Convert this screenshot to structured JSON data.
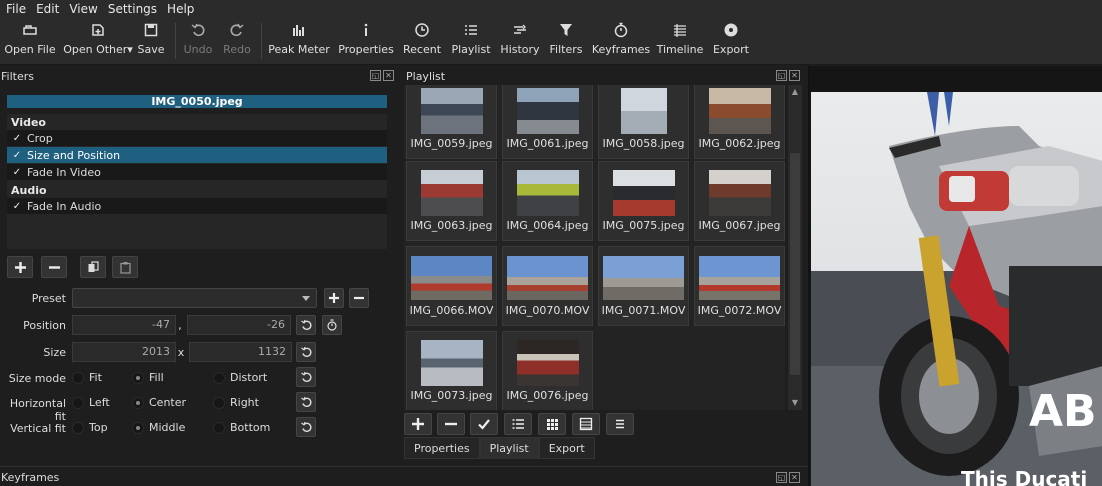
{
  "menu": [
    "File",
    "Edit",
    "View",
    "Settings",
    "Help"
  ],
  "toolbar": {
    "open_file": "Open File",
    "open_other": "Open Other",
    "save": "Save",
    "undo": "Undo",
    "redo": "Redo",
    "peak_meter": "Peak Meter",
    "properties": "Properties",
    "recent": "Recent",
    "playlist": "Playlist",
    "history": "History",
    "filters": "Filters",
    "keyframes": "Keyframes",
    "timeline": "Timeline",
    "export": "Export"
  },
  "filters": {
    "title": "Filters",
    "clip_name": "IMG_0050.jpeg",
    "video_label": "Video",
    "audio_label": "Audio",
    "video_filters": [
      {
        "check": "✓",
        "name": "Crop",
        "selected": false
      },
      {
        "check": "✓",
        "name": "Size and Position",
        "selected": true
      },
      {
        "check": "✓",
        "name": "Fade In Video",
        "selected": false
      }
    ],
    "audio_filters": [
      {
        "check": "✓",
        "name": "Fade In Audio",
        "selected": false
      }
    ]
  },
  "params": {
    "preset_label": "Preset",
    "preset_value": "",
    "position_label": "Position",
    "position_x": "-47",
    "position_sep": ",",
    "position_y": "-26",
    "size_label": "Size",
    "size_w": "2013",
    "size_sep": "x",
    "size_h": "1132",
    "size_mode_label": "Size mode",
    "size_mode_options": [
      "Fit",
      "Fill",
      "Distort"
    ],
    "size_mode_selected": "Fill",
    "hfit_label": "Horizontal fit",
    "hfit_options": [
      "Left",
      "Center",
      "Right"
    ],
    "hfit_selected": "Center",
    "vfit_label": "Vertical fit",
    "vfit_options": [
      "Top",
      "Middle",
      "Bottom"
    ],
    "vfit_selected": "Middle"
  },
  "playlist": {
    "title": "Playlist",
    "items": [
      "IMG_0059.jpeg",
      "IMG_0061.jpeg",
      "IMG_0058.jpeg",
      "IMG_0062.jpeg",
      "IMG_0063.jpeg",
      "IMG_0064.jpeg",
      "IMG_0075.jpeg",
      "IMG_0067.jpeg",
      "IMG_0066.MOV",
      "IMG_0070.MOV",
      "IMG_0071.MOV",
      "IMG_0072.MOV",
      "IMG_0073.jpeg",
      "IMG_0076.jpeg"
    ],
    "tabs": [
      "Properties",
      "Playlist",
      "Export"
    ],
    "active_tab": "Playlist"
  },
  "keyframes": {
    "title": "Keyframes"
  },
  "viewer": {
    "overlay_big": "AB",
    "overlay_caption": "This Ducati"
  },
  "colors": {
    "accent": "#1f5f7f",
    "panel_bg": "#1e1e1e",
    "toolbar_bg": "#2b2b2b"
  }
}
